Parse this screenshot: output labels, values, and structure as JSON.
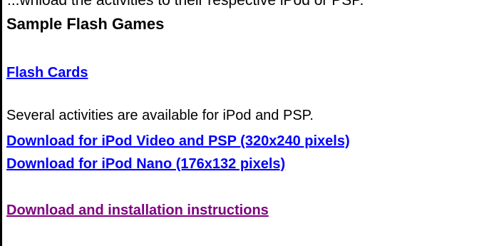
{
  "page": {
    "cut_off_top_text": "...wnload the activities to their respective iPod or PSP.",
    "heading": "Sample Flash Games",
    "flash_cards_link": "Flash Cards",
    "description": "Several activities are available for iPod and PSP.",
    "download_video_psp_link": "Download for iPod Video and PSP (320x240 pixels)",
    "download_nano_link": "Download for iPod Nano (176x132 pixels)",
    "instructions_link": "Download and installation instructions"
  },
  "colors": {
    "link": "#0000ff",
    "visited_link": "#800080",
    "text": "#000000",
    "background": "#ffffff"
  }
}
